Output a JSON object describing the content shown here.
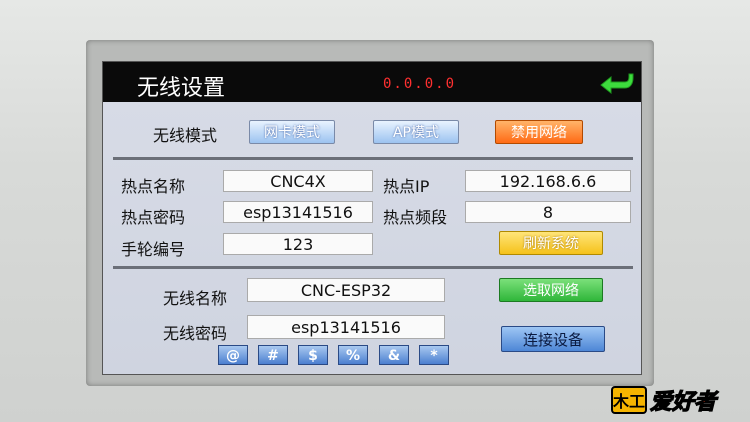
{
  "header": {
    "title": "无线设置",
    "ip_display": "0.0.0.0"
  },
  "wifi_mode": {
    "label": "无线模式",
    "buttons": [
      "网卡模式",
      "AP模式",
      "禁用网络"
    ]
  },
  "hotspot": {
    "name_label": "热点名称",
    "name_value": "CNC4X",
    "ip_label": "热点IP",
    "ip_value": "192.168.6.6",
    "password_label": "热点密码",
    "password_value": "esp13141516",
    "channel_label": "热点频段",
    "channel_value": "8",
    "handwheel_label": "手轮编号",
    "handwheel_value": "123",
    "refresh_button": "刷新系统"
  },
  "wireless": {
    "name_label": "无线名称",
    "name_value": "CNC-ESP32",
    "select_button": "选取网络",
    "password_label": "无线密码",
    "password_value": "esp13141516",
    "connect_button": "连接设备",
    "symbols": [
      "@",
      "#",
      "$",
      "%",
      "&",
      "*"
    ]
  },
  "watermark": {
    "text": "爱好者",
    "prefix": "木工"
  },
  "colors": {
    "title_bg": "#0a0a0a",
    "ip_red": "#ff3030",
    "back_arrow": "#3ddc3d"
  }
}
